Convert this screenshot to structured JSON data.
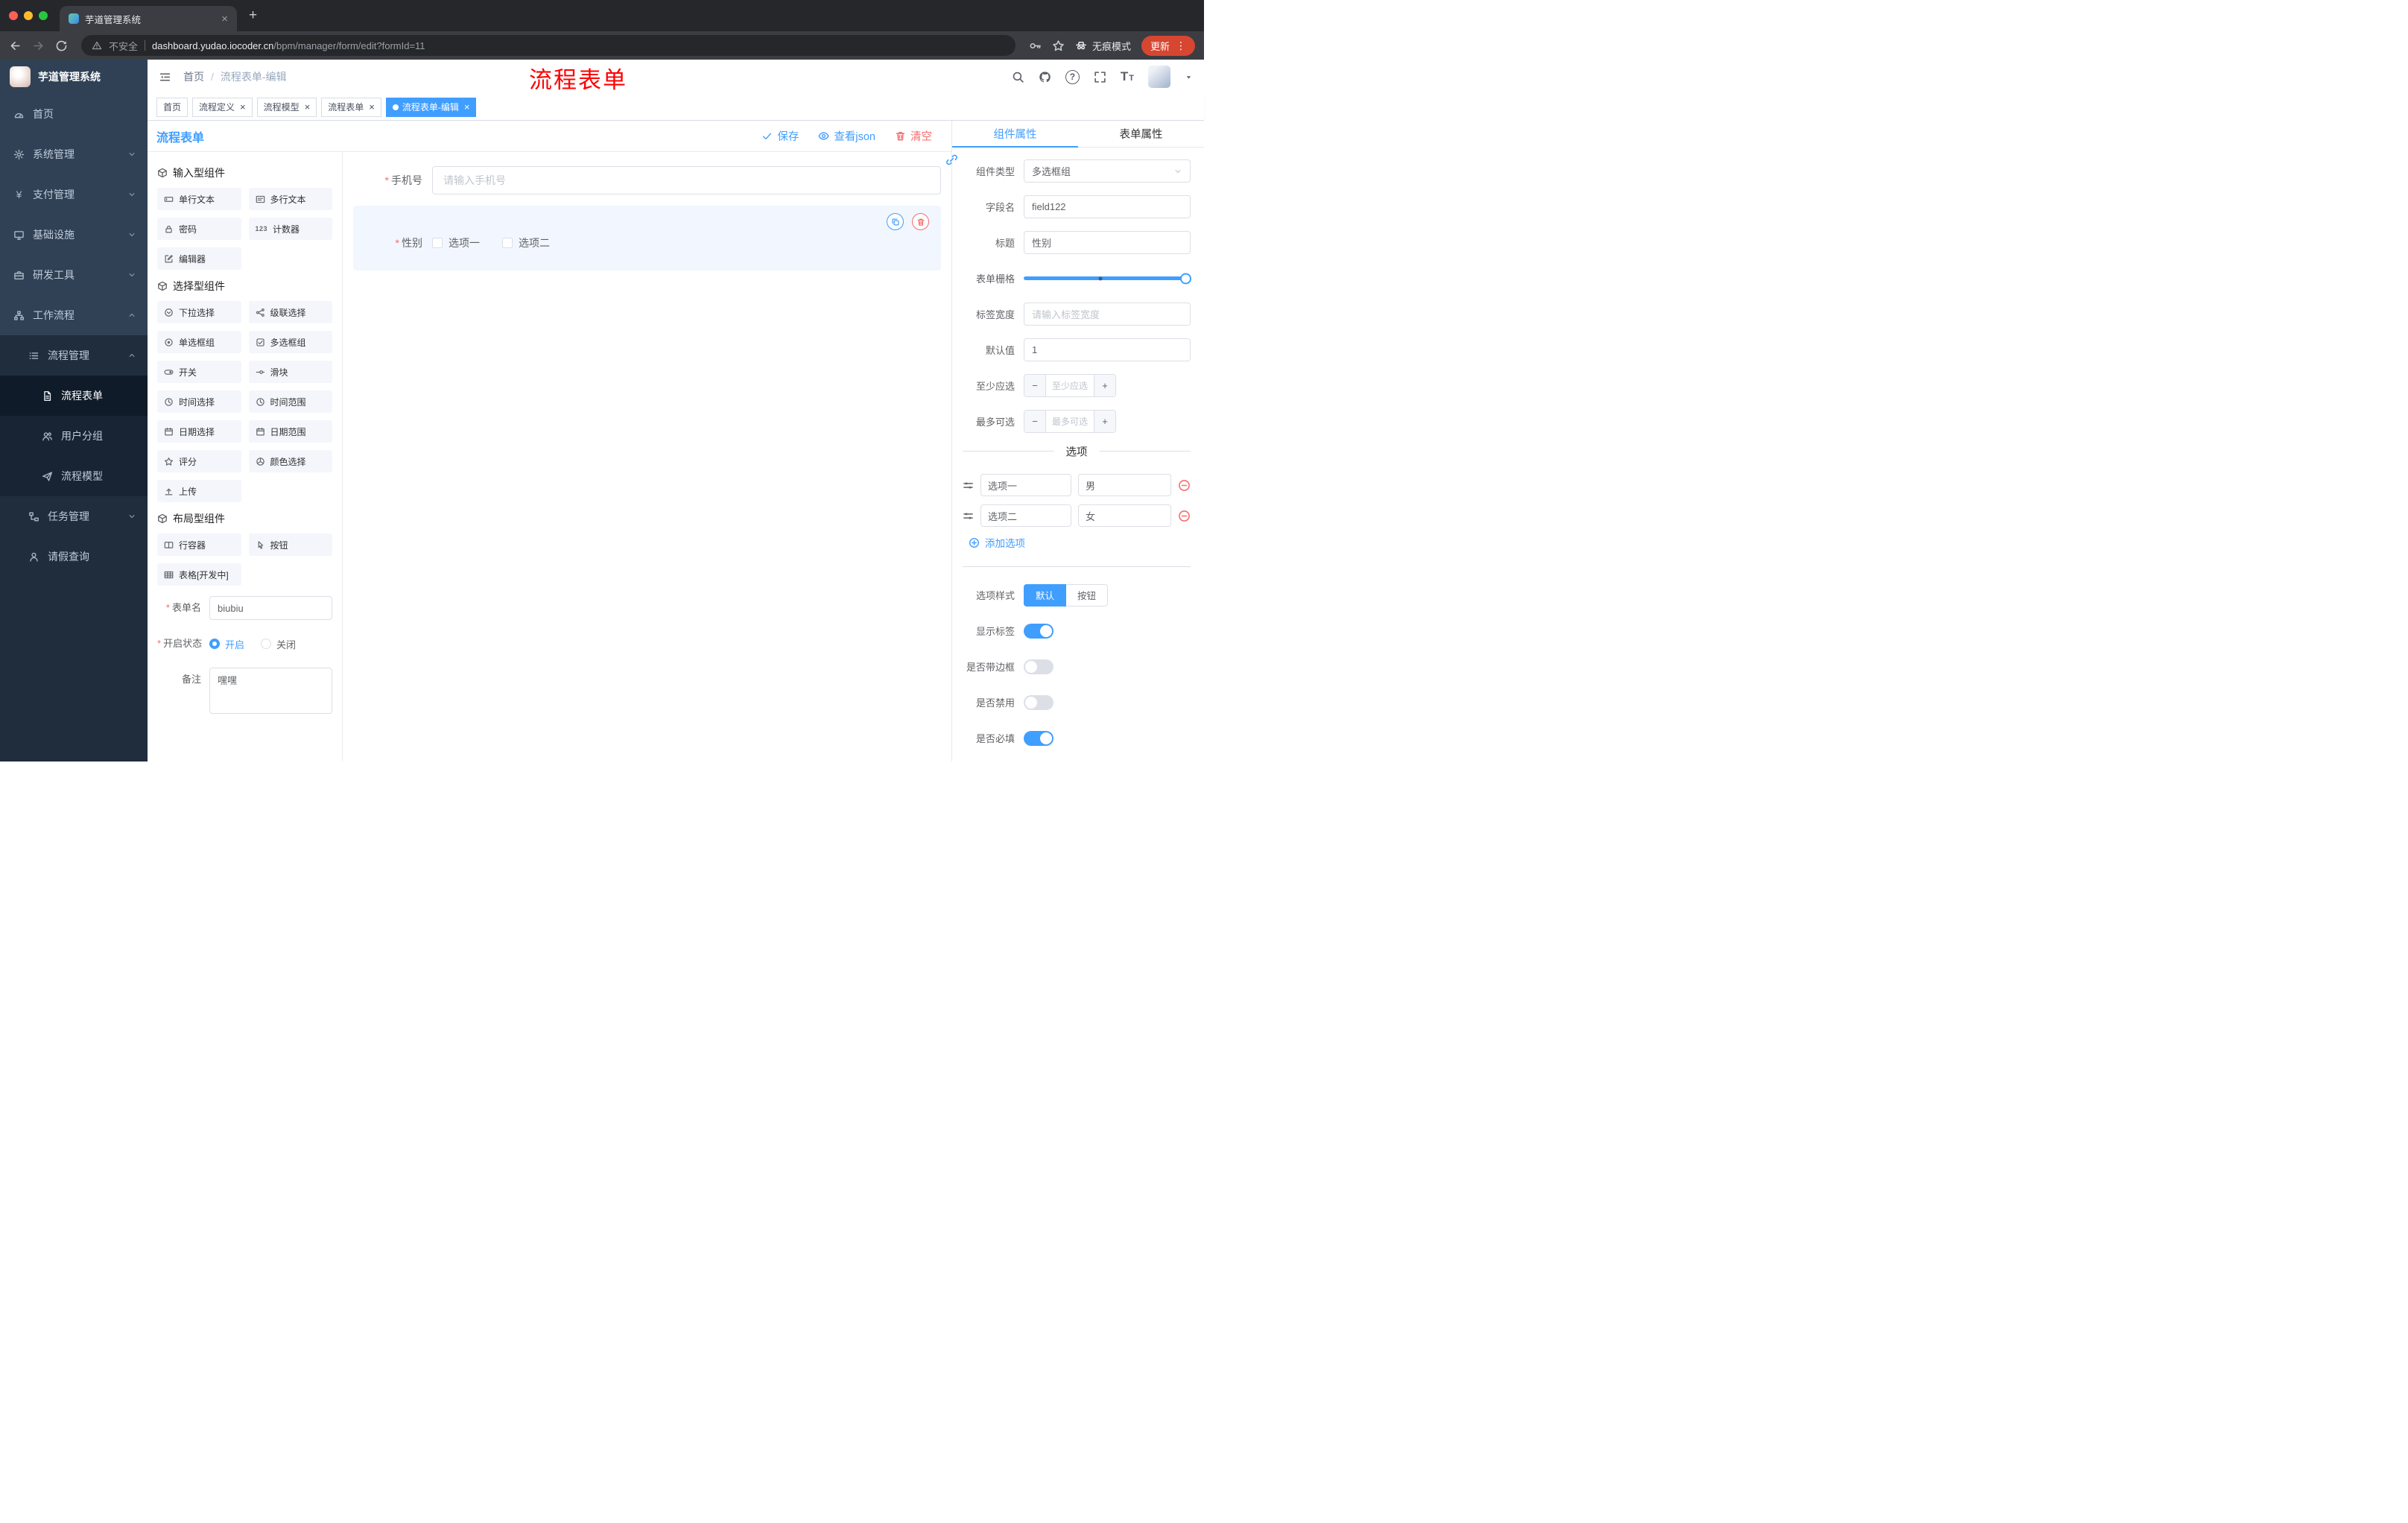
{
  "browser": {
    "tab_title": "芋道管理系统",
    "url": {
      "security": "不安全",
      "domain": "dashboard.yudao.iocoder.cn",
      "path": "/bpm/manager/form/edit?formId=11"
    },
    "incognito": "无痕模式",
    "update": "更新"
  },
  "sidebar": {
    "logo": "芋道管理系统",
    "items": [
      {
        "label": "首页"
      },
      {
        "label": "系统管理"
      },
      {
        "label": "支付管理"
      },
      {
        "label": "基础设施"
      },
      {
        "label": "研发工具"
      },
      {
        "label": "工作流程"
      },
      {
        "label": "流程管理"
      },
      {
        "label": "流程表单"
      },
      {
        "label": "用户分组"
      },
      {
        "label": "流程模型"
      },
      {
        "label": "任务管理"
      },
      {
        "label": "请假查询"
      }
    ]
  },
  "header": {
    "breadcrumb": {
      "home": "首页",
      "sep": "/",
      "current": "流程表单-编辑"
    },
    "annotation": "流程表单"
  },
  "tags": [
    {
      "label": "首页"
    },
    {
      "label": "流程定义"
    },
    {
      "label": "流程模型"
    },
    {
      "label": "流程表单"
    },
    {
      "label": "流程表单-编辑"
    }
  ],
  "designer": {
    "title": "流程表单",
    "actions": {
      "save": "保存",
      "view_json": "查看json",
      "clear": "清空"
    },
    "groups": [
      {
        "title": "输入型组件",
        "items": [
          {
            "label": "单行文本"
          },
          {
            "label": "多行文本"
          },
          {
            "label": "密码"
          },
          {
            "label": "计数器"
          },
          {
            "label": "编辑器"
          }
        ]
      },
      {
        "title": "选择型组件",
        "items": [
          {
            "label": "下拉选择"
          },
          {
            "label": "级联选择"
          },
          {
            "label": "单选框组"
          },
          {
            "label": "多选框组"
          },
          {
            "label": "开关"
          },
          {
            "label": "滑块"
          },
          {
            "label": "时间选择"
          },
          {
            "label": "时间范围"
          },
          {
            "label": "日期选择"
          },
          {
            "label": "日期范围"
          },
          {
            "label": "评分"
          },
          {
            "label": "颜色选择"
          },
          {
            "label": "上传"
          }
        ]
      },
      {
        "title": "布局型组件",
        "items": [
          {
            "label": "行容器"
          },
          {
            "label": "按钮"
          },
          {
            "label": "表格[开发中]"
          }
        ]
      }
    ],
    "settings": {
      "form_name_label": "表单名",
      "form_name_value": "biubiu",
      "status_label": "开启状态",
      "status_on": "开启",
      "status_off": "关闭",
      "remark_label": "备注",
      "remark_value": "嘿嘿"
    },
    "canvas": {
      "phone_label": "手机号",
      "phone_placeholder": "请输入手机号",
      "gender_label": "性别",
      "gender_option1": "选项一",
      "gender_option2": "选项二"
    }
  },
  "props": {
    "tab_component": "组件属性",
    "tab_form": "表单属性",
    "component_type_label": "组件类型",
    "component_type_value": "多选框组",
    "field_name_label": "字段名",
    "field_name_value": "field122",
    "title_label": "标题",
    "title_value": "性别",
    "grid_label": "表单栅格",
    "label_width_label": "标签宽度",
    "label_width_placeholder": "请输入标签宽度",
    "default_label": "默认值",
    "default_value": "1",
    "min_label": "至少应选",
    "min_placeholder": "至少应选",
    "max_label": "最多可选",
    "max_placeholder": "最多可选",
    "options_title": "选项",
    "options": [
      {
        "label": "选项一",
        "value": "男"
      },
      {
        "label": "选项二",
        "value": "女"
      }
    ],
    "add_option": "添加选项",
    "style_label": "选项样式",
    "style_default": "默认",
    "style_button": "按钮",
    "toggle_show_label": "显示标签",
    "toggle_border": "是否带边框",
    "toggle_disabled": "是否禁用",
    "toggle_required": "是否必填"
  },
  "glyphs": {
    "close": "×",
    "plus": "+",
    "dots": "⋮",
    "help": "?",
    "font_large": "T",
    "font_small": "T",
    "counter": "123",
    "minus": "−",
    "asterisk": "*"
  },
  "colors": {
    "primary": "#409eff",
    "danger": "#f56c6c",
    "annotation_red": "#fe0000",
    "update_badge": "#d74631",
    "sidebar_bg": "#304156",
    "submenu_bg": "#1f2d3d",
    "active_tag": "#409eff"
  }
}
